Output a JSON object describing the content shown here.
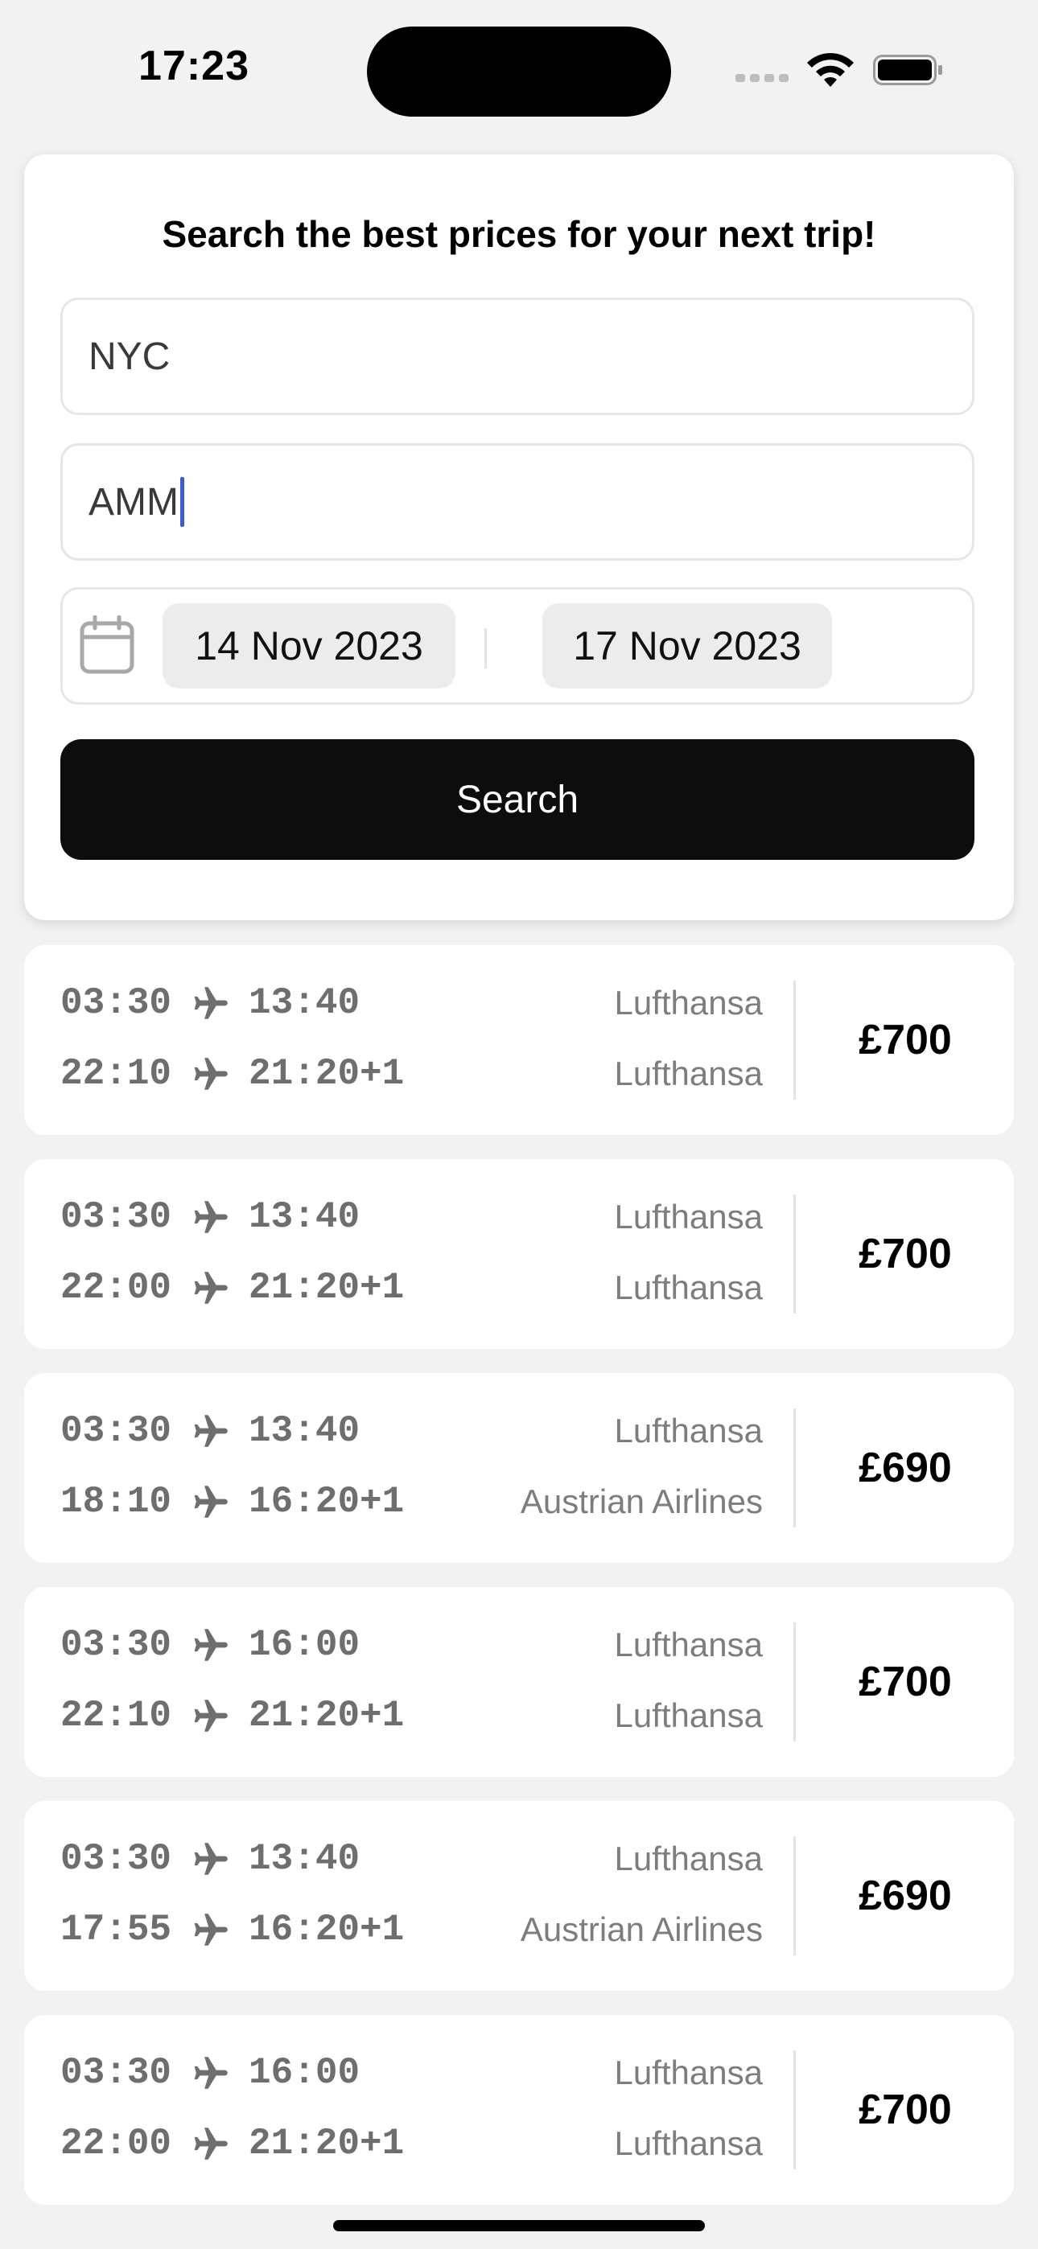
{
  "status_bar": {
    "time": "17:23"
  },
  "search": {
    "title": "Search the best prices for your next trip!",
    "from_value": "NYC",
    "to_value": "AMM",
    "start_date": "14 Nov 2023",
    "end_date": "17 Nov 2023",
    "button_label": "Search"
  },
  "results": [
    {
      "out_depart": "03:30",
      "out_arrive": "13:40",
      "ret_depart": "22:10",
      "ret_arrive": "21:20+1",
      "out_airline": "Lufthansa",
      "ret_airline": "Lufthansa",
      "price": "£700"
    },
    {
      "out_depart": "03:30",
      "out_arrive": "13:40",
      "ret_depart": "22:00",
      "ret_arrive": "21:20+1",
      "out_airline": "Lufthansa",
      "ret_airline": "Lufthansa",
      "price": "£700"
    },
    {
      "out_depart": "03:30",
      "out_arrive": "13:40",
      "ret_depart": "18:10",
      "ret_arrive": "16:20+1",
      "out_airline": "Lufthansa",
      "ret_airline": "Austrian Airlines",
      "price": "£690"
    },
    {
      "out_depart": "03:30",
      "out_arrive": "16:00",
      "ret_depart": "22:10",
      "ret_arrive": "21:20+1",
      "out_airline": "Lufthansa",
      "ret_airline": "Lufthansa",
      "price": "£700"
    },
    {
      "out_depart": "03:30",
      "out_arrive": "13:40",
      "ret_depart": "17:55",
      "ret_arrive": "16:20+1",
      "out_airline": "Lufthansa",
      "ret_airline": "Austrian Airlines",
      "price": "£690"
    },
    {
      "out_depart": "03:30",
      "out_arrive": "16:00",
      "ret_depart": "22:00",
      "ret_arrive": "21:20+1",
      "out_airline": "Lufthansa",
      "ret_airline": "Lufthansa",
      "price": "£700"
    }
  ],
  "icons": {
    "calendar": "calendar-icon",
    "plane": "plane-icon",
    "wifi": "wifi-icon",
    "battery": "battery-icon",
    "signal": "cellular-signal-icon"
  }
}
